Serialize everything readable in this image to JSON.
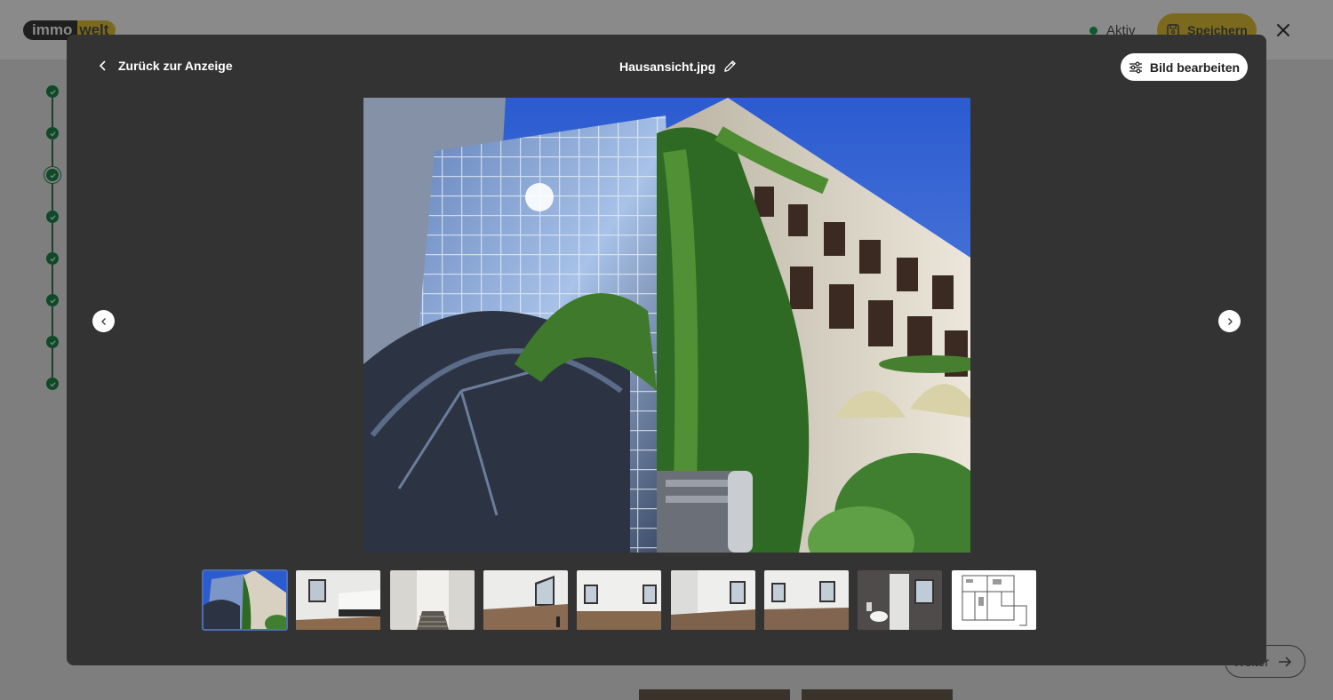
{
  "header": {
    "logo_part1": "immo",
    "logo_part2": "welt",
    "status_label": "Aktiv",
    "save_label": "Speichern"
  },
  "background": {
    "next_label": "Weiter",
    "steps_total": 8,
    "current_step": 3
  },
  "modal": {
    "back_label": "Zurück zur Anzeige",
    "file_name": "Hausansicht.jpg",
    "edit_image_label": "Bild bearbeiten",
    "selected_thumbnail": 1,
    "thumbnails": [
      {
        "kind": "facade"
      },
      {
        "kind": "kitchen"
      },
      {
        "kind": "stairs"
      },
      {
        "kind": "room"
      },
      {
        "kind": "room"
      },
      {
        "kind": "room"
      },
      {
        "kind": "room"
      },
      {
        "kind": "bathroom"
      },
      {
        "kind": "floorplan"
      }
    ]
  },
  "colors": {
    "brand_yellow": "#f5d400",
    "success_green": "#1a8a4a",
    "modal_bg": "#333333"
  }
}
